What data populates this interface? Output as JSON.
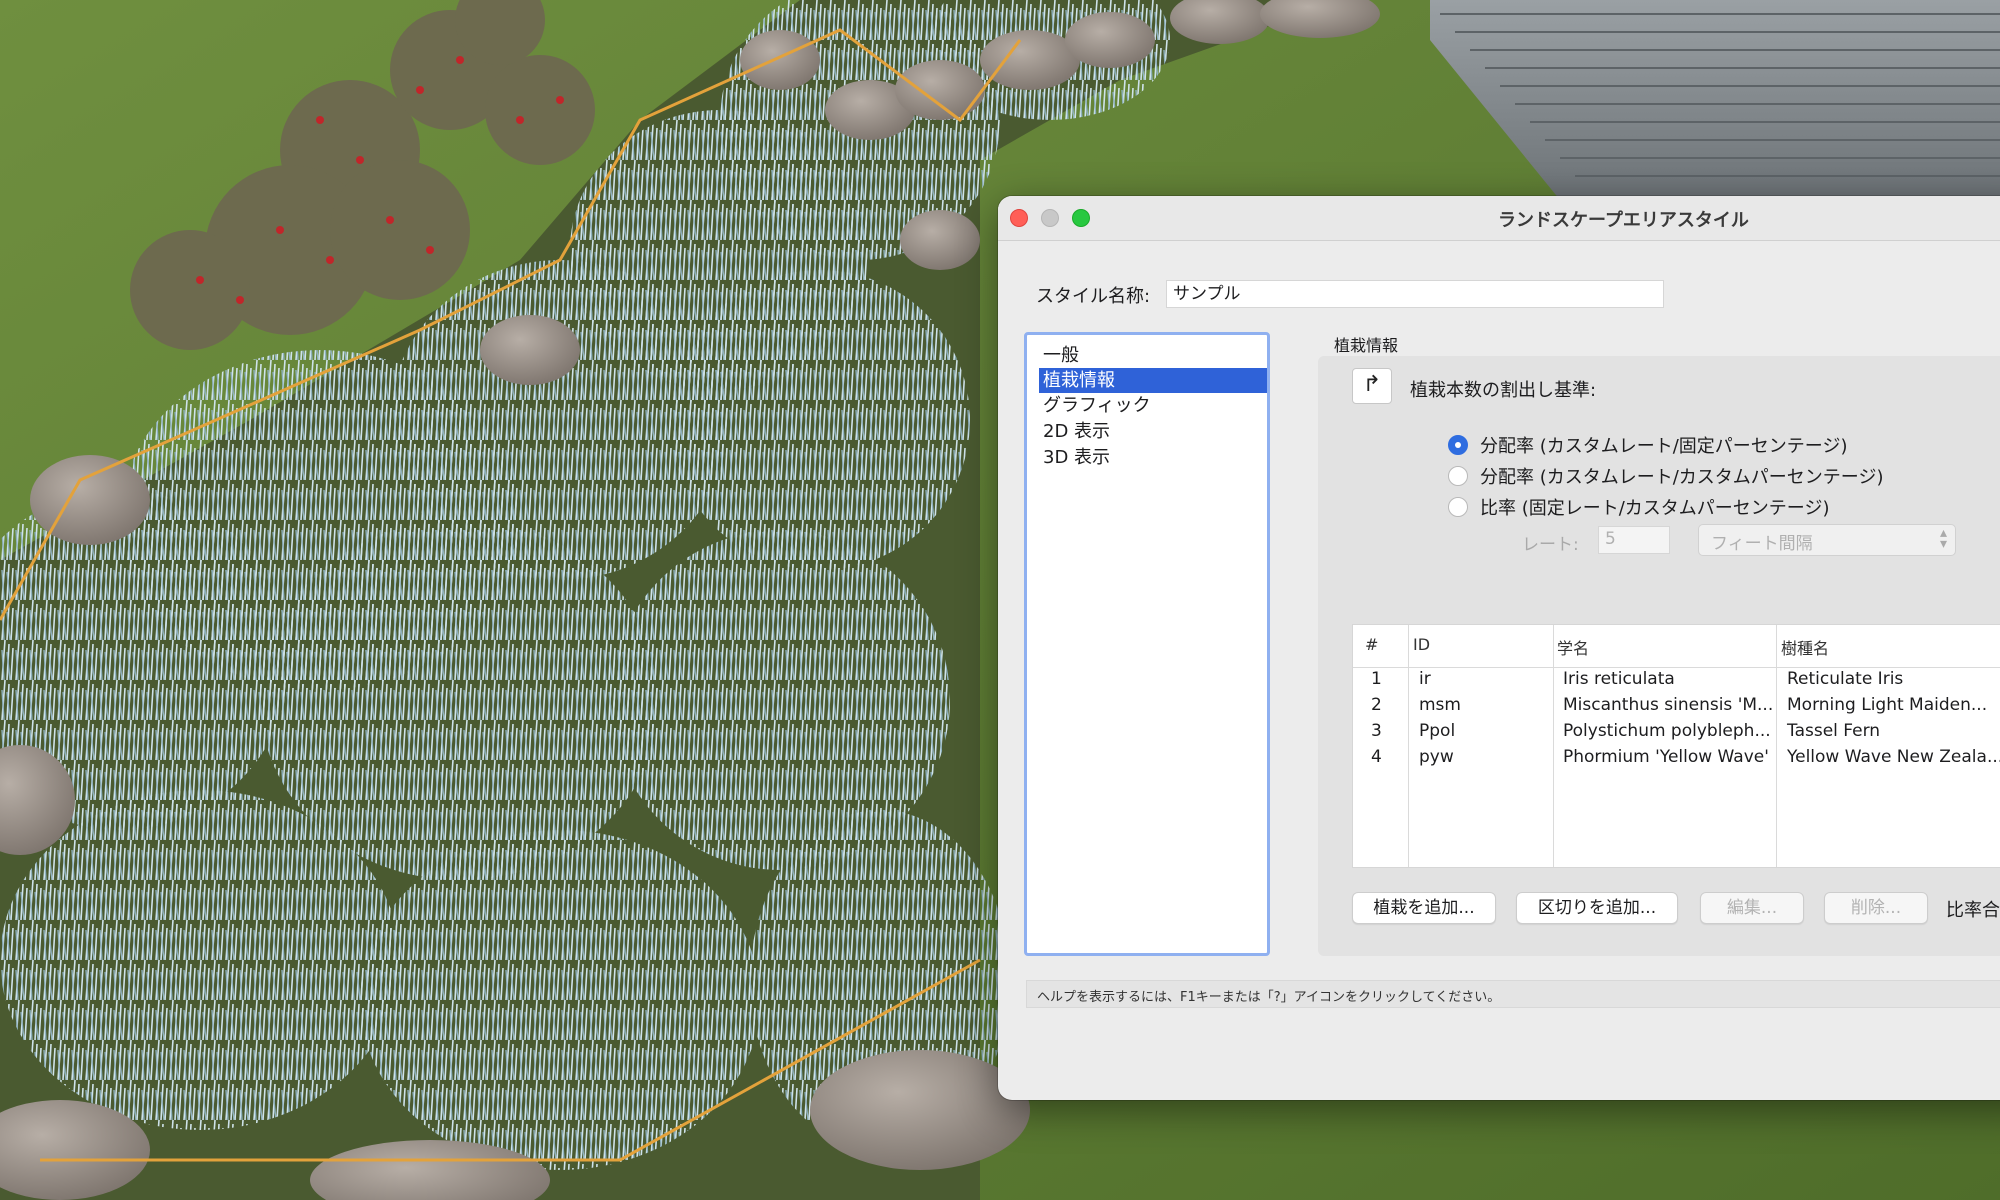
{
  "dialog": {
    "title": "ランドスケープエリアスタイル",
    "style_name_label": "スタイル名称:",
    "style_name_value": "サンプル",
    "categories": [
      {
        "label": "一般",
        "selected": false
      },
      {
        "label": "植栽情報",
        "selected": true
      },
      {
        "label": "グラフィック",
        "selected": false
      },
      {
        "label": "2D 表示",
        "selected": false
      },
      {
        "label": "3D 表示",
        "selected": false
      }
    ],
    "section_title": "植栽情報",
    "calc_basis_label": "植栽本数の割出し基準:",
    "radio_options": [
      {
        "label": "分配率 (カスタムレート/固定パーセンテージ)",
        "checked": true
      },
      {
        "label": "分配率 (カスタムレート/カスタムパーセンテージ)",
        "checked": false
      },
      {
        "label": "比率 (固定レート/カスタムパーセンテージ)",
        "checked": false
      }
    ],
    "rate_label": "レート:",
    "rate_value": "5",
    "unit_select": "フィート間隔",
    "table": {
      "headers": [
        "#",
        "ID",
        "学名",
        "樹種名"
      ],
      "rows": [
        [
          "1",
          "ir",
          "Iris reticulata",
          "Reticulate Iris"
        ],
        [
          "2",
          "msm",
          "Miscanthus sinensis 'M...",
          "Morning Light Maiden..."
        ],
        [
          "3",
          "Ppol",
          "Polystichum polybleph...",
          "Tassel Fern"
        ],
        [
          "4",
          "pyw",
          "Phormium 'Yellow Wave'",
          "Yellow Wave New Zeala..."
        ]
      ]
    },
    "buttons": {
      "add_plant": "植栽を追加...",
      "add_separator": "区切りを追加...",
      "edit": "編集...",
      "delete": "削除..."
    },
    "ratio_total_label": "比率合",
    "help_text": "ヘルプを表示するには、F1キーまたは「?」アイコンをクリックしてください。"
  },
  "icons": {
    "window_close": "close-icon",
    "window_minimize": "minimize-icon",
    "window_zoom": "zoom-icon",
    "toggle_arrow": "curved-arrow-icon",
    "select_chevron": "chevron-updown-icon"
  },
  "colors": {
    "selection_blue": "#2f62d8",
    "radio_blue": "#2f6de0",
    "close_red": "#ff5f57",
    "zoom_green": "#28c840"
  }
}
